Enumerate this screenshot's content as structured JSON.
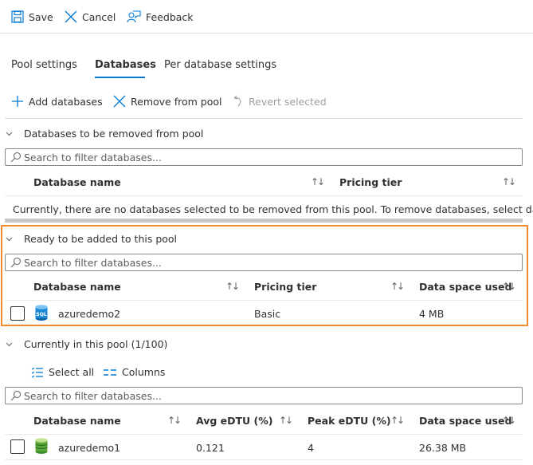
{
  "command_bar": {
    "save": "Save",
    "cancel": "Cancel",
    "feedback": "Feedback"
  },
  "tabs": [
    {
      "label": "Pool settings",
      "active": false
    },
    {
      "label": "Databases",
      "active": true
    },
    {
      "label": "Per database settings",
      "active": false
    }
  ],
  "toolbar": {
    "add": "Add databases",
    "remove": "Remove from pool",
    "revert": "Revert selected"
  },
  "colors": {
    "accent": "#0078d4",
    "highlight": "#f38b2c",
    "disabled": "#a19f9d"
  },
  "sections": {
    "remove": {
      "title": "Databases to be removed from pool",
      "search_placeholder": "Search to filter databases...",
      "columns": [
        "Database name",
        "Pricing tier"
      ],
      "empty_message": "Currently, there are no databases selected to be removed from this pool. To remove databases, select data..."
    },
    "ready": {
      "title": "Ready to be added to this pool",
      "search_placeholder": "Search to filter databases...",
      "columns": [
        "Database name",
        "Pricing tier",
        "Data space used"
      ],
      "rows": [
        {
          "name": "azuredemo2",
          "icon": "sql-database-icon",
          "pricing_tier": "Basic",
          "data_space_used": "4 MB"
        }
      ]
    },
    "current": {
      "title": "Currently in this pool (1/100)",
      "select_all": "Select all",
      "columns_button": "Columns",
      "search_placeholder": "Search to filter databases...",
      "columns": [
        "Database name",
        "Avg eDTU (%)",
        "Peak eDTU (%)",
        "Data space used"
      ],
      "rows": [
        {
          "name": "azuredemo1",
          "icon": "database-icon",
          "avg_edtu": "0.121",
          "peak_edtu": "4",
          "data_space_used": "26.38 MB"
        }
      ]
    }
  },
  "sort_glyph": "↑↓"
}
